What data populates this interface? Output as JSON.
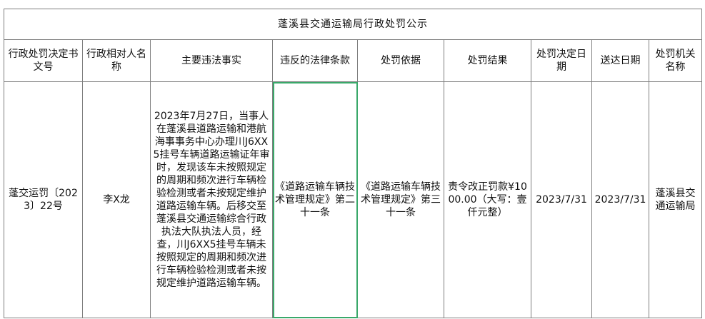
{
  "sheet": {
    "title": "蓬溪县交通运输局行政处罚公示",
    "headers": [
      "行政处罚决定书文号",
      "行政相对人名称",
      "主要违法事实",
      "违反的法律条款",
      "处罚依据",
      "处罚结果",
      "处罚决定日期",
      "送达日期",
      "处罚机关名称"
    ],
    "row": {
      "doc_no": "蓬交运罚〔2023〕22号",
      "party": "李X龙",
      "facts": "2023年7月27日，当事人在蓬溪县道路运输和港航海事事务中心办理川J6XX5挂号车辆道路运输证年审时，发现该车未按照规定的周期和频次进行车辆检验检测或者未按规定维护道路运输车辆。后移交至蓬溪县交通运输综合行政执法大队执法人员，经查，川J6XX5挂号车辆未按照规定的周期和频次进行车辆检验检测或者未按规定维护道路运输车辆。",
      "violated_clause": "《道路运输车辆技术管理规定》第二十一条",
      "basis": "《道路运输车辆技术管理规定》第三十一条",
      "result": "责令改正罚款¥1000.00（大写：壹仟元整）",
      "decision_date": "2023/7/31",
      "delivery_date": "2023/7/31",
      "authority": "蓬溪县交通运输局"
    }
  }
}
